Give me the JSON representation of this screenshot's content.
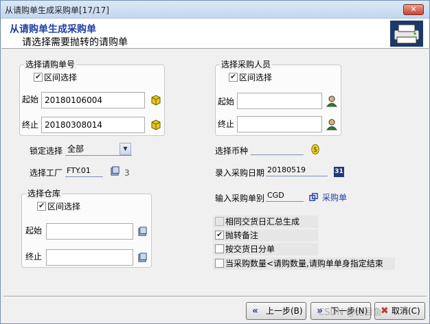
{
  "window": {
    "title": "从请购单生成采购单[17/17]",
    "close_label": "✕"
  },
  "header": {
    "title": "从请购单生成采购单",
    "subtitle": "请选择需要抛转的请购单"
  },
  "requisition_group": {
    "legend": "选择请购单号",
    "range_label": "区间选择",
    "start_label": "起始",
    "start_value": "20180106004",
    "end_label": "终止",
    "end_value": "20180308014"
  },
  "buyer_group": {
    "legend": "选择采购人员",
    "range_label": "区间选择",
    "start_label": "起始",
    "start_value": "",
    "end_label": "终止",
    "end_value": ""
  },
  "lock": {
    "label": "锁定选择",
    "value": "全部"
  },
  "factory": {
    "label": "选择工厂",
    "value": "FTY.01"
  },
  "currency": {
    "label": "选择币种",
    "value": ""
  },
  "purchase_date": {
    "label": "录入采购日期",
    "value": "20180519",
    "calendar_label": "31"
  },
  "purchase_type": {
    "label": "输入采购单别",
    "value": "CGD",
    "link_label": "采购单"
  },
  "warehouse_group": {
    "legend": "选择仓库",
    "range_label": "区间选择",
    "start_label": "起始",
    "start_value": "",
    "end_label": "终止",
    "end_value": ""
  },
  "options": [
    {
      "label": "相同交货日汇总生成",
      "checked": false
    },
    {
      "label": "抛转备注",
      "checked": true
    },
    {
      "label": "按交货日分单",
      "checked": false
    },
    {
      "label": "当采购数量<请购数量,请购单单身指定结束",
      "checked": false
    }
  ],
  "footer": {
    "prev_label": "上一步(B)",
    "next_label": "下一步(N)",
    "cancel_label": "取消(C)",
    "watermark": "CSDN @比目鱼"
  },
  "colors": {
    "accent": "#1f3ea3",
    "title_bar": "#c4d7ef"
  }
}
